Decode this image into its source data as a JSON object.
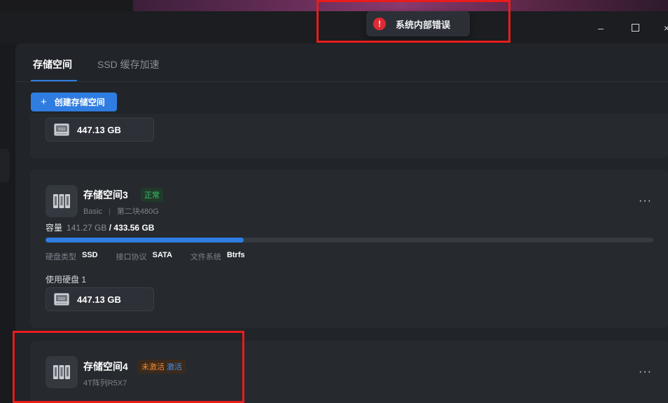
{
  "window": {
    "minimize_glyph": "–",
    "close_glyph": "×"
  },
  "tabs": [
    {
      "label": "存储空间",
      "active": true
    },
    {
      "label": "SSD 缓存加速",
      "active": false
    }
  ],
  "toolbar": {
    "create_plus": "+",
    "create_label": "创建存储空间"
  },
  "toast": {
    "icon": "error-icon",
    "icon_glyph": "!",
    "message": "系统内部错误"
  },
  "pools": [
    {
      "disk_chips": [
        "447.13 GB"
      ]
    },
    {
      "name": "存储空间3",
      "status": "正常",
      "raid": "Basic",
      "description": "第二块480G",
      "capacity_label": "容量",
      "capacity_used": "141.27 GB",
      "capacity_total": "/ 433.56 GB",
      "usage_fraction": 0.326,
      "disk_type_label": "硬盘类型",
      "disk_type": "SSD",
      "interface_label": "接口协议",
      "interface": "SATA",
      "fs_label": "文件系统",
      "fs": "Btrfs",
      "used_disks_label": "使用硬盘 1",
      "disk_chips": [
        "447.13 GB"
      ],
      "more": "···"
    },
    {
      "name": "存储空间4",
      "status": "未激活",
      "action": "激活",
      "description": "4T阵列R5X7",
      "more": "···"
    }
  ],
  "colors": {
    "accent": "#2f7de1",
    "ok": "#3fbf6a",
    "warn": "#f08a2c",
    "error": "#e02a33",
    "annotation": "#e81c1c"
  }
}
